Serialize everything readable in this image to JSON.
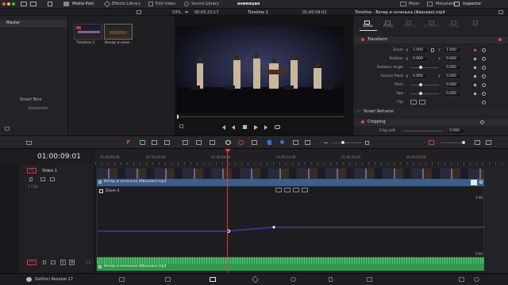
{
  "topbar": {
    "media_pool": "Media Pool",
    "effects_library": "Effects Library",
    "edit_index": "Edit Index",
    "sound_library": "Sound Library",
    "project_title": "анимация",
    "mixer": "Mixer",
    "metadata": "Metadata",
    "inspector": "Inspector"
  },
  "viewer_bar": {
    "zoom": "53%",
    "source_timecode": "00:05:23:17",
    "timeline_name": "Timeline 1",
    "record_timecode": "01:00:09:01",
    "inspector_title": "Timeline - Вечер и ноченька (Иваново).mp4"
  },
  "media_pool": {
    "bin_master": "Master",
    "smart_bins": "Smart Bins",
    "keywords": "Keywords",
    "clips": [
      {
        "name": "Timeline 1"
      },
      {
        "name": "Вечер и ноче..."
      }
    ]
  },
  "inspector": {
    "tabs": [
      "Video",
      "Audio",
      "Effects",
      "Transition",
      "Image",
      "File"
    ],
    "section_transform": "Transform",
    "rows": [
      {
        "label": "Zoom",
        "axis1": "X",
        "v1": "1.000",
        "axis2": "Y",
        "v2": "1.000"
      },
      {
        "label": "Position",
        "axis1": "X",
        "v1": "0.000",
        "axis2": "Y",
        "v2": "0.000"
      },
      {
        "label": "Rotation Angle",
        "v1": "0.000"
      },
      {
        "label": "Anchor Point",
        "axis1": "X",
        "v1": "0.000",
        "axis2": "Y",
        "v2": "0.000"
      },
      {
        "label": "Pitch",
        "v1": "0.000"
      },
      {
        "label": "Yaw",
        "v1": "0.000"
      },
      {
        "label": "Flip"
      }
    ],
    "section_smart_reframe": "Smart Reframe",
    "section_cropping": "Cropping",
    "crop_left_label": "Crop Left",
    "crop_left_value": "0.000"
  },
  "timeline": {
    "timecode": "01:00:09:01",
    "ruler_ticks": [
      "01:00:00:00",
      "01:00:04:00",
      "01:00:08:00",
      "01:00:12:00",
      "01:00:16:00",
      "01:00:20:00"
    ],
    "video_track_badge": "V1",
    "video_track_name": "Video 1",
    "video_clip_count": "1 Clip",
    "video_clip_name": "Вечер и ноченька (Иваново).mp4",
    "curve_label": "Zoom X",
    "curve_max": "2.00",
    "curve_min": "0.00",
    "audio_track_badge": "A1",
    "audio_channels": "2.0",
    "audio_clip_name": "Вечер и ноченька (Иваново).mp4"
  },
  "bottom": {
    "app_name": "DaVinci Resolve 17"
  },
  "colors": {
    "playhead": "#e23a32",
    "video_clip": "#3b5f8a",
    "audio_clip": "#2f9a4c",
    "curve": "#4a4ad6"
  }
}
